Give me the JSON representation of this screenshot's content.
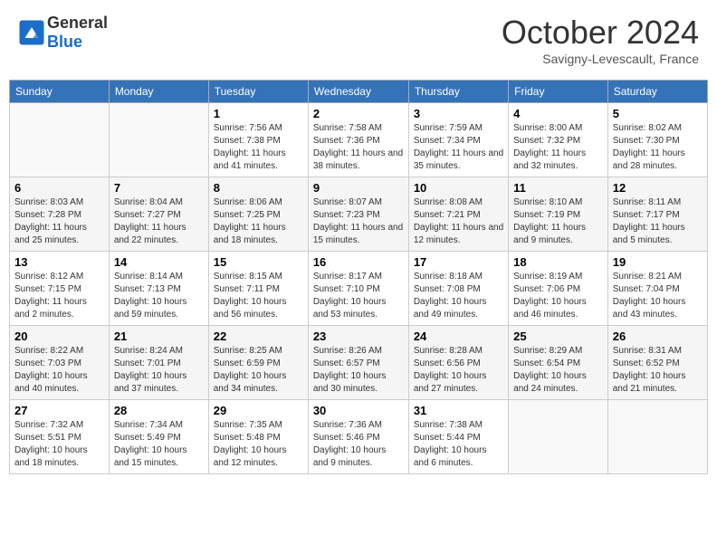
{
  "header": {
    "logo_general": "General",
    "logo_blue": "Blue",
    "month": "October 2024",
    "location": "Savigny-Levescault, France"
  },
  "days_of_week": [
    "Sunday",
    "Monday",
    "Tuesday",
    "Wednesday",
    "Thursday",
    "Friday",
    "Saturday"
  ],
  "weeks": [
    [
      {
        "day": "",
        "info": ""
      },
      {
        "day": "",
        "info": ""
      },
      {
        "day": "1",
        "sunrise": "7:56 AM",
        "sunset": "7:38 PM",
        "daylight": "11 hours and 41 minutes."
      },
      {
        "day": "2",
        "sunrise": "7:58 AM",
        "sunset": "7:36 PM",
        "daylight": "11 hours and 38 minutes."
      },
      {
        "day": "3",
        "sunrise": "7:59 AM",
        "sunset": "7:34 PM",
        "daylight": "11 hours and 35 minutes."
      },
      {
        "day": "4",
        "sunrise": "8:00 AM",
        "sunset": "7:32 PM",
        "daylight": "11 hours and 32 minutes."
      },
      {
        "day": "5",
        "sunrise": "8:02 AM",
        "sunset": "7:30 PM",
        "daylight": "11 hours and 28 minutes."
      }
    ],
    [
      {
        "day": "6",
        "sunrise": "8:03 AM",
        "sunset": "7:28 PM",
        "daylight": "11 hours and 25 minutes."
      },
      {
        "day": "7",
        "sunrise": "8:04 AM",
        "sunset": "7:27 PM",
        "daylight": "11 hours and 22 minutes."
      },
      {
        "day": "8",
        "sunrise": "8:06 AM",
        "sunset": "7:25 PM",
        "daylight": "11 hours and 18 minutes."
      },
      {
        "day": "9",
        "sunrise": "8:07 AM",
        "sunset": "7:23 PM",
        "daylight": "11 hours and 15 minutes."
      },
      {
        "day": "10",
        "sunrise": "8:08 AM",
        "sunset": "7:21 PM",
        "daylight": "11 hours and 12 minutes."
      },
      {
        "day": "11",
        "sunrise": "8:10 AM",
        "sunset": "7:19 PM",
        "daylight": "11 hours and 9 minutes."
      },
      {
        "day": "12",
        "sunrise": "8:11 AM",
        "sunset": "7:17 PM",
        "daylight": "11 hours and 5 minutes."
      }
    ],
    [
      {
        "day": "13",
        "sunrise": "8:12 AM",
        "sunset": "7:15 PM",
        "daylight": "11 hours and 2 minutes."
      },
      {
        "day": "14",
        "sunrise": "8:14 AM",
        "sunset": "7:13 PM",
        "daylight": "10 hours and 59 minutes."
      },
      {
        "day": "15",
        "sunrise": "8:15 AM",
        "sunset": "7:11 PM",
        "daylight": "10 hours and 56 minutes."
      },
      {
        "day": "16",
        "sunrise": "8:17 AM",
        "sunset": "7:10 PM",
        "daylight": "10 hours and 53 minutes."
      },
      {
        "day": "17",
        "sunrise": "8:18 AM",
        "sunset": "7:08 PM",
        "daylight": "10 hours and 49 minutes."
      },
      {
        "day": "18",
        "sunrise": "8:19 AM",
        "sunset": "7:06 PM",
        "daylight": "10 hours and 46 minutes."
      },
      {
        "day": "19",
        "sunrise": "8:21 AM",
        "sunset": "7:04 PM",
        "daylight": "10 hours and 43 minutes."
      }
    ],
    [
      {
        "day": "20",
        "sunrise": "8:22 AM",
        "sunset": "7:03 PM",
        "daylight": "10 hours and 40 minutes."
      },
      {
        "day": "21",
        "sunrise": "8:24 AM",
        "sunset": "7:01 PM",
        "daylight": "10 hours and 37 minutes."
      },
      {
        "day": "22",
        "sunrise": "8:25 AM",
        "sunset": "6:59 PM",
        "daylight": "10 hours and 34 minutes."
      },
      {
        "day": "23",
        "sunrise": "8:26 AM",
        "sunset": "6:57 PM",
        "daylight": "10 hours and 30 minutes."
      },
      {
        "day": "24",
        "sunrise": "8:28 AM",
        "sunset": "6:56 PM",
        "daylight": "10 hours and 27 minutes."
      },
      {
        "day": "25",
        "sunrise": "8:29 AM",
        "sunset": "6:54 PM",
        "daylight": "10 hours and 24 minutes."
      },
      {
        "day": "26",
        "sunrise": "8:31 AM",
        "sunset": "6:52 PM",
        "daylight": "10 hours and 21 minutes."
      }
    ],
    [
      {
        "day": "27",
        "sunrise": "7:32 AM",
        "sunset": "5:51 PM",
        "daylight": "10 hours and 18 minutes."
      },
      {
        "day": "28",
        "sunrise": "7:34 AM",
        "sunset": "5:49 PM",
        "daylight": "10 hours and 15 minutes."
      },
      {
        "day": "29",
        "sunrise": "7:35 AM",
        "sunset": "5:48 PM",
        "daylight": "10 hours and 12 minutes."
      },
      {
        "day": "30",
        "sunrise": "7:36 AM",
        "sunset": "5:46 PM",
        "daylight": "10 hours and 9 minutes."
      },
      {
        "day": "31",
        "sunrise": "7:38 AM",
        "sunset": "5:44 PM",
        "daylight": "10 hours and 6 minutes."
      },
      {
        "day": "",
        "info": ""
      },
      {
        "day": "",
        "info": ""
      }
    ]
  ]
}
